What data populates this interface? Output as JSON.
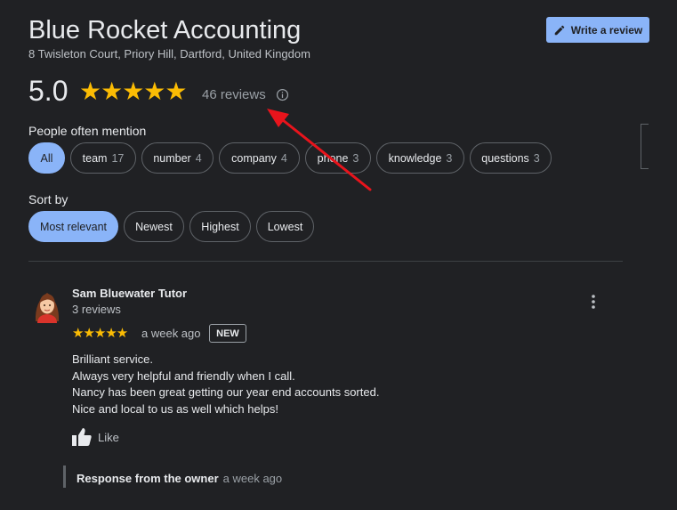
{
  "business": {
    "name": "Blue Rocket Accounting",
    "address": "8 Twisleton Court, Priory Hill, Dartford, United Kingdom",
    "rating": "5.0",
    "stars": "★★★★★",
    "review_count": "46 reviews",
    "write_review_label": "Write a review"
  },
  "mentions": {
    "label": "People often mention",
    "chips": [
      {
        "label": "All",
        "count": "",
        "selected": true
      },
      {
        "label": "team",
        "count": "17"
      },
      {
        "label": "number",
        "count": "4"
      },
      {
        "label": "company",
        "count": "4"
      },
      {
        "label": "phone",
        "count": "3"
      },
      {
        "label": "knowledge",
        "count": "3"
      },
      {
        "label": "questions",
        "count": "3"
      }
    ]
  },
  "sort": {
    "label": "Sort by",
    "options": [
      "Most relevant",
      "Newest",
      "Highest",
      "Lowest"
    ],
    "selected": "Most relevant"
  },
  "review": {
    "author": "Sam Bluewater Tutor",
    "author_reviews": "3 reviews",
    "stars": "★★★★★",
    "rating": 5,
    "date": "a week ago",
    "badge": "NEW",
    "lines": [
      "Brilliant service.",
      "Always very helpful and friendly when I call.",
      "Nancy has been great getting our year end accounts sorted.",
      "Nice and local to us as well which helps!"
    ],
    "like_label": "Like",
    "response_label": "Response from the owner",
    "response_date": "a week ago"
  },
  "colors": {
    "background": "#202124",
    "accent": "#8ab4f8",
    "star": "#fbbc04",
    "annotation_arrow": "#e8141c"
  },
  "icons": [
    "pencil-icon",
    "info-icon",
    "more-vert-icon",
    "thumbs-up-icon",
    "avatar"
  ]
}
